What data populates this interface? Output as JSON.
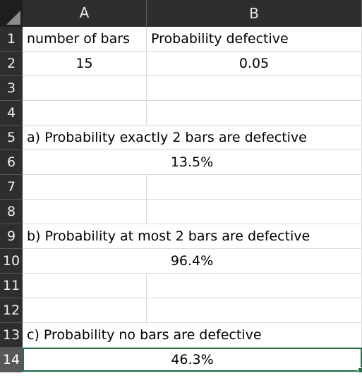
{
  "columns": [
    "A",
    "B"
  ],
  "rows": [
    {
      "num": "1",
      "a": "number of bars",
      "b": "Probability defective"
    },
    {
      "num": "2",
      "a": "15",
      "b": "0.05"
    },
    {
      "num": "3",
      "a": "",
      "b": ""
    },
    {
      "num": "4",
      "a": "",
      "b": ""
    },
    {
      "num": "5",
      "merged": "a) Probability exactly 2 bars are defective"
    },
    {
      "num": "6",
      "merged": "13.5%"
    },
    {
      "num": "7",
      "a": "",
      "b": ""
    },
    {
      "num": "8",
      "a": "",
      "b": ""
    },
    {
      "num": "9",
      "merged": "b) Probability at most 2 bars are defective"
    },
    {
      "num": "10",
      "merged": "96.4%"
    },
    {
      "num": "11",
      "a": "",
      "b": ""
    },
    {
      "num": "12",
      "a": "",
      "b": ""
    },
    {
      "num": "13",
      "merged": "c) Probability no bars are defective"
    },
    {
      "num": "14",
      "merged": "46.3%"
    }
  ],
  "selected_cell": "A14",
  "colors": {
    "selection": "#217346",
    "header_bg": "#2e2e2e",
    "gridline": "#d9d9d9"
  }
}
